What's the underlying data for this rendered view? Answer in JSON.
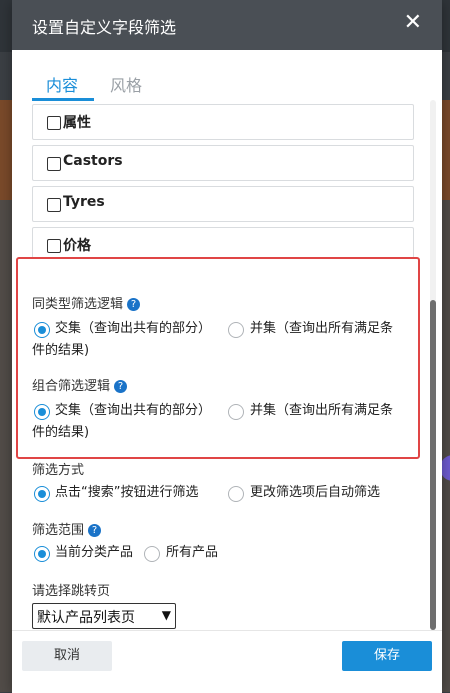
{
  "modal": {
    "title": "设置自定义字段筛选",
    "close_icon": "close-icon"
  },
  "tabs": [
    {
      "label": "内容",
      "active": true
    },
    {
      "label": "风格",
      "active": false
    }
  ],
  "fields": [
    {
      "label": "属性",
      "checked": false
    },
    {
      "label": "Castors",
      "checked": false
    },
    {
      "label": "Tyres",
      "checked": false
    },
    {
      "label": "价格",
      "checked": false
    }
  ],
  "same_type_logic": {
    "title": "同类型筛选逻辑",
    "options": [
      {
        "label": "交集（查询出共有的部分）",
        "selected": true
      },
      {
        "label": "并集（查询出所有满足条",
        "selected": false
      }
    ],
    "wrap_text": "件的结果)"
  },
  "combo_logic": {
    "title": "组合筛选逻辑",
    "options": [
      {
        "label": "交集（查询出共有的部分）",
        "selected": true
      },
      {
        "label": "并集（查询出所有满足条",
        "selected": false
      }
    ],
    "wrap_text": "件的结果)"
  },
  "filter_mode": {
    "title": "筛选方式",
    "options": [
      {
        "label": "点击“搜索”按钮进行筛选",
        "selected": true
      },
      {
        "label": "更改筛选项后自动筛选",
        "selected": false
      }
    ]
  },
  "filter_scope": {
    "title": "筛选范围",
    "options": [
      {
        "label": "当前分类产品",
        "selected": true
      },
      {
        "label": "所有产品",
        "selected": false
      }
    ]
  },
  "redirect": {
    "title": "请选择跳转页",
    "selected": "默认产品列表页"
  },
  "footer": {
    "cancel_label": "取消",
    "save_label": "保存"
  },
  "colors": {
    "accent": "#1a8ed8",
    "header_bg": "#4a4f55",
    "highlight": "#e04545"
  }
}
